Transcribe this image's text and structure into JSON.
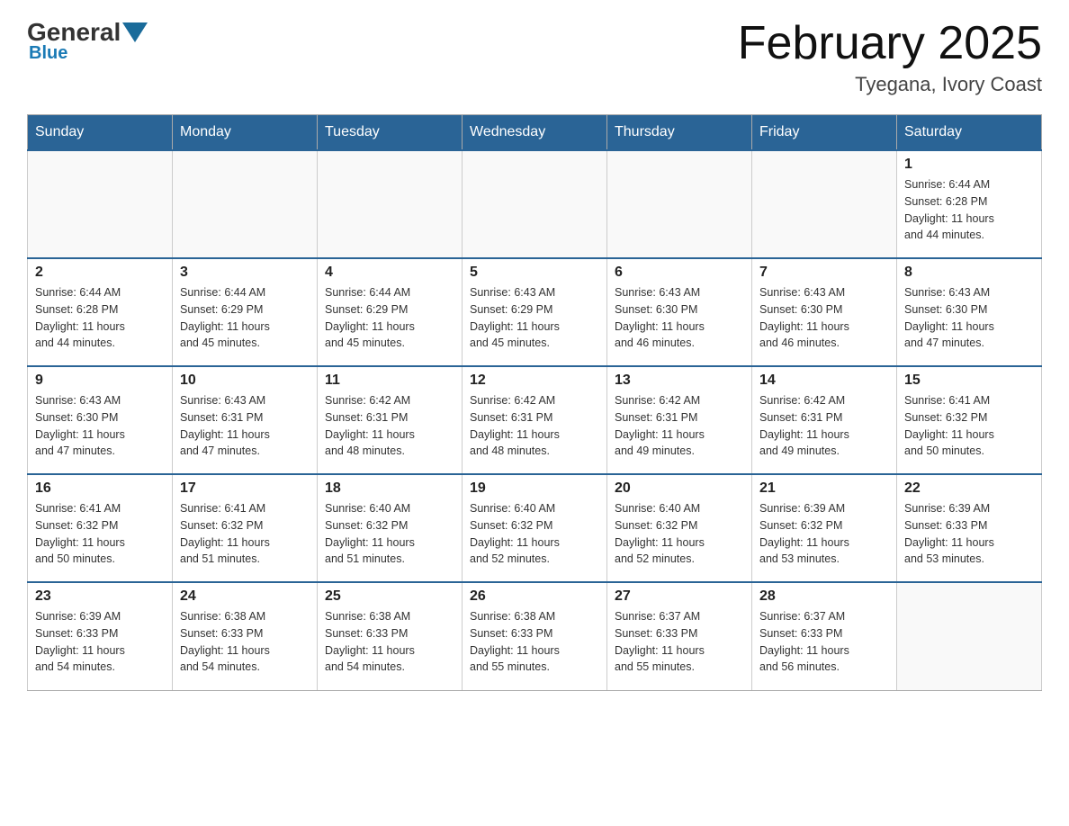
{
  "header": {
    "logo_general": "General",
    "logo_blue": "Blue",
    "month_title": "February 2025",
    "location": "Tyegana, Ivory Coast"
  },
  "days_of_week": [
    "Sunday",
    "Monday",
    "Tuesday",
    "Wednesday",
    "Thursday",
    "Friday",
    "Saturday"
  ],
  "weeks": [
    {
      "days": [
        {
          "date": "",
          "info": ""
        },
        {
          "date": "",
          "info": ""
        },
        {
          "date": "",
          "info": ""
        },
        {
          "date": "",
          "info": ""
        },
        {
          "date": "",
          "info": ""
        },
        {
          "date": "",
          "info": ""
        },
        {
          "date": "1",
          "info": "Sunrise: 6:44 AM\nSunset: 6:28 PM\nDaylight: 11 hours\nand 44 minutes."
        }
      ]
    },
    {
      "days": [
        {
          "date": "2",
          "info": "Sunrise: 6:44 AM\nSunset: 6:28 PM\nDaylight: 11 hours\nand 44 minutes."
        },
        {
          "date": "3",
          "info": "Sunrise: 6:44 AM\nSunset: 6:29 PM\nDaylight: 11 hours\nand 45 minutes."
        },
        {
          "date": "4",
          "info": "Sunrise: 6:44 AM\nSunset: 6:29 PM\nDaylight: 11 hours\nand 45 minutes."
        },
        {
          "date": "5",
          "info": "Sunrise: 6:43 AM\nSunset: 6:29 PM\nDaylight: 11 hours\nand 45 minutes."
        },
        {
          "date": "6",
          "info": "Sunrise: 6:43 AM\nSunset: 6:30 PM\nDaylight: 11 hours\nand 46 minutes."
        },
        {
          "date": "7",
          "info": "Sunrise: 6:43 AM\nSunset: 6:30 PM\nDaylight: 11 hours\nand 46 minutes."
        },
        {
          "date": "8",
          "info": "Sunrise: 6:43 AM\nSunset: 6:30 PM\nDaylight: 11 hours\nand 47 minutes."
        }
      ]
    },
    {
      "days": [
        {
          "date": "9",
          "info": "Sunrise: 6:43 AM\nSunset: 6:30 PM\nDaylight: 11 hours\nand 47 minutes."
        },
        {
          "date": "10",
          "info": "Sunrise: 6:43 AM\nSunset: 6:31 PM\nDaylight: 11 hours\nand 47 minutes."
        },
        {
          "date": "11",
          "info": "Sunrise: 6:42 AM\nSunset: 6:31 PM\nDaylight: 11 hours\nand 48 minutes."
        },
        {
          "date": "12",
          "info": "Sunrise: 6:42 AM\nSunset: 6:31 PM\nDaylight: 11 hours\nand 48 minutes."
        },
        {
          "date": "13",
          "info": "Sunrise: 6:42 AM\nSunset: 6:31 PM\nDaylight: 11 hours\nand 49 minutes."
        },
        {
          "date": "14",
          "info": "Sunrise: 6:42 AM\nSunset: 6:31 PM\nDaylight: 11 hours\nand 49 minutes."
        },
        {
          "date": "15",
          "info": "Sunrise: 6:41 AM\nSunset: 6:32 PM\nDaylight: 11 hours\nand 50 minutes."
        }
      ]
    },
    {
      "days": [
        {
          "date": "16",
          "info": "Sunrise: 6:41 AM\nSunset: 6:32 PM\nDaylight: 11 hours\nand 50 minutes."
        },
        {
          "date": "17",
          "info": "Sunrise: 6:41 AM\nSunset: 6:32 PM\nDaylight: 11 hours\nand 51 minutes."
        },
        {
          "date": "18",
          "info": "Sunrise: 6:40 AM\nSunset: 6:32 PM\nDaylight: 11 hours\nand 51 minutes."
        },
        {
          "date": "19",
          "info": "Sunrise: 6:40 AM\nSunset: 6:32 PM\nDaylight: 11 hours\nand 52 minutes."
        },
        {
          "date": "20",
          "info": "Sunrise: 6:40 AM\nSunset: 6:32 PM\nDaylight: 11 hours\nand 52 minutes."
        },
        {
          "date": "21",
          "info": "Sunrise: 6:39 AM\nSunset: 6:32 PM\nDaylight: 11 hours\nand 53 minutes."
        },
        {
          "date": "22",
          "info": "Sunrise: 6:39 AM\nSunset: 6:33 PM\nDaylight: 11 hours\nand 53 minutes."
        }
      ]
    },
    {
      "days": [
        {
          "date": "23",
          "info": "Sunrise: 6:39 AM\nSunset: 6:33 PM\nDaylight: 11 hours\nand 54 minutes."
        },
        {
          "date": "24",
          "info": "Sunrise: 6:38 AM\nSunset: 6:33 PM\nDaylight: 11 hours\nand 54 minutes."
        },
        {
          "date": "25",
          "info": "Sunrise: 6:38 AM\nSunset: 6:33 PM\nDaylight: 11 hours\nand 54 minutes."
        },
        {
          "date": "26",
          "info": "Sunrise: 6:38 AM\nSunset: 6:33 PM\nDaylight: 11 hours\nand 55 minutes."
        },
        {
          "date": "27",
          "info": "Sunrise: 6:37 AM\nSunset: 6:33 PM\nDaylight: 11 hours\nand 55 minutes."
        },
        {
          "date": "28",
          "info": "Sunrise: 6:37 AM\nSunset: 6:33 PM\nDaylight: 11 hours\nand 56 minutes."
        },
        {
          "date": "",
          "info": ""
        }
      ]
    }
  ]
}
